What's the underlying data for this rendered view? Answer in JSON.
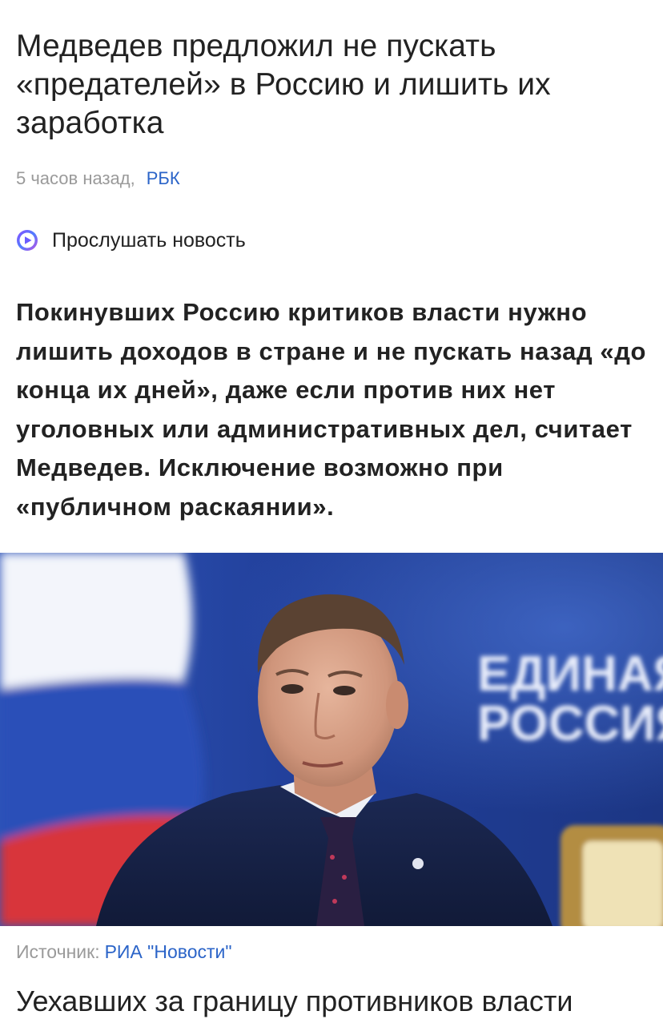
{
  "article": {
    "title": "Медведев предложил не пускать «предателей» в Россию и лишить их заработка",
    "time": "5 часов назад,",
    "source": "РБК",
    "listen_label": "Прослушать новость",
    "lead": "Покинувших Россию критиков власти нужно лишить доходов в стране и не пускать назад «до конца их дней», даже если против них нет уголовных или административных дел, считает Медведев. Исключение возможно при «публичном раскаянии».",
    "photo": {
      "background_text_line1": "ЕДИНАЯ",
      "background_text_line2": "РОССИЯ"
    },
    "caption_label": "Источник:",
    "caption_source": "РИА \"Новости\"",
    "next_paragraph_start": "Уехавших за границу противников власти"
  },
  "colors": {
    "text": "#222222",
    "muted": "#9a9a9a",
    "link": "#2b64c8"
  },
  "icons": {
    "listen": "alice-play-icon"
  }
}
